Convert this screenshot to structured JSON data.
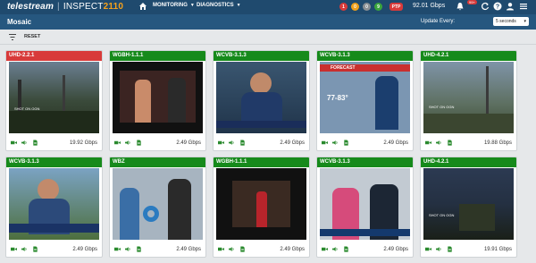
{
  "header": {
    "brand": "telestream",
    "product": "INSPECT",
    "version": "2110",
    "nav": [
      {
        "label": "MONITORING"
      },
      {
        "label": "DIAGNOSTICS"
      }
    ],
    "status_counts": [
      {
        "value": "1",
        "color": "#d83a3a"
      },
      {
        "value": "0",
        "color": "#f0a01a"
      },
      {
        "value": "0",
        "color": "#8a8f94"
      },
      {
        "value": "9",
        "color": "#3aa53d"
      }
    ],
    "ptp_label": "PTP",
    "throughput": "92.01 Gbps",
    "notification_count": "99+"
  },
  "subheader": {
    "title": "Mosaic",
    "update_label": "Update Every:",
    "update_value": "5 seconds"
  },
  "toolbar": {
    "reset_label": "RESET"
  },
  "tiles": [
    {
      "name": "UHD-2.2.1",
      "status": "alarm",
      "rate": "19.92 Gbps"
    },
    {
      "name": "WGBH-1.1.1",
      "status": "ok",
      "rate": "2.49 Gbps"
    },
    {
      "name": "WCVB-3.1.3",
      "status": "ok",
      "rate": "2.49 Gbps"
    },
    {
      "name": "WCVB-3.1.3",
      "status": "ok",
      "rate": "2.49 Gbps"
    },
    {
      "name": "UHD-4.2.1",
      "status": "ok",
      "rate": "19.88 Gbps"
    },
    {
      "name": "WCVB-3.1.3",
      "status": "ok",
      "rate": "2.49 Gbps"
    },
    {
      "name": "WBZ",
      "status": "ok",
      "rate": "2.49 Gbps"
    },
    {
      "name": "WGBH-1.1.1",
      "status": "ok",
      "rate": "2.49 Gbps"
    },
    {
      "name": "WCVB-3.1.3",
      "status": "ok",
      "rate": "2.49 Gbps"
    },
    {
      "name": "UHD-4.2.1",
      "status": "ok",
      "rate": "19.91 Gbps"
    }
  ],
  "video_overlays": {
    "forecast": "FORECAST",
    "temp": "77-83°",
    "shot_on": "SHOT ON OGN"
  }
}
